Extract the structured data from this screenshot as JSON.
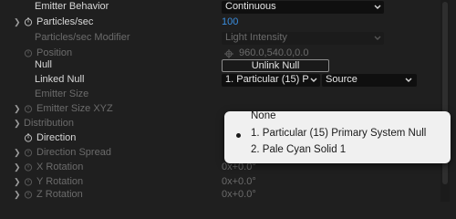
{
  "rows": {
    "emitter_behavior": {
      "label": "Emitter Behavior",
      "value": "Continuous"
    },
    "particles_sec": {
      "label": "Particles/sec",
      "value": "100"
    },
    "particles_sec_modifier": {
      "label": "Particles/sec Modifier",
      "value": "Light Intensity"
    },
    "position": {
      "label": "Position",
      "value": "960.0,540.0,0.0"
    },
    "null": {
      "label": "Null",
      "button": "Unlink Null"
    },
    "linked_null": {
      "label": "Linked Null",
      "value": "1. Particular (15) P",
      "source": "Source"
    },
    "emitter_size": {
      "label": "Emitter Size"
    },
    "emitter_size_xyz": {
      "label": "Emitter Size XYZ"
    },
    "distribution": {
      "label": "Distribution"
    },
    "direction": {
      "label": "Direction"
    },
    "direction_spread": {
      "label": "Direction Spread"
    },
    "x_rotation": {
      "label": "X Rotation",
      "value": "0x+0.0°"
    },
    "y_rotation": {
      "label": "Y Rotation",
      "value": "0x+0.0°"
    },
    "z_rotation": {
      "label": "Z Rotation",
      "value": "0x+0.0°"
    }
  },
  "dropdown": {
    "options": [
      "None",
      "1. Particular (15) Primary System Null",
      "2. Pale Cyan Solid 1"
    ],
    "selected_index": 1
  }
}
